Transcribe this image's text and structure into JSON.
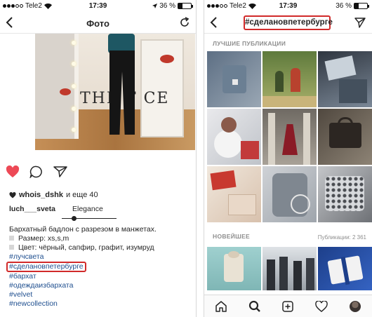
{
  "left": {
    "status": {
      "carrier": "Tele2",
      "time": "17:39",
      "battery": "36 %",
      "battery_level": 0.36
    },
    "nav": {
      "title": "Фото",
      "back_icon": "chevron-left-icon",
      "refresh_icon": "refresh-icon"
    },
    "photo": {
      "letters": "THE T CE"
    },
    "actions": {
      "liked": true,
      "like_color": "#ed4956"
    },
    "likes": {
      "user": "whois_dshk",
      "rest": "и еще 40"
    },
    "tagged": [
      "luch___sveta",
      "Elegance"
    ],
    "caption": {
      "text": "Бархатный бадлон с разрезом в манжетах.",
      "size": "Размер: xs,s,m",
      "colors": "Цвет: чёрный, сапфир, графит, изумруд"
    },
    "hashtags": [
      "#лучсвета",
      "#сделановпетербурге",
      "#бархат",
      "#одеждаизбархата",
      "#velvet",
      "#newcollection"
    ],
    "highlight_color": "#d12a2a",
    "link_color": "#1f4f8f"
  },
  "right": {
    "nav": {
      "title": "#сделановпетербурге",
      "back_icon": "chevron-left-icon",
      "send_icon": "direct-send-icon"
    },
    "top_label": "ЛУЧШИЕ ПУБЛИКАЦИИ",
    "recent_label": "НОВЕЙШЕЕ",
    "pub_count": "Публикации: 2 361",
    "tabs": [
      "home-icon",
      "search-icon",
      "add-icon",
      "heart-icon",
      "profile-avatar"
    ]
  }
}
